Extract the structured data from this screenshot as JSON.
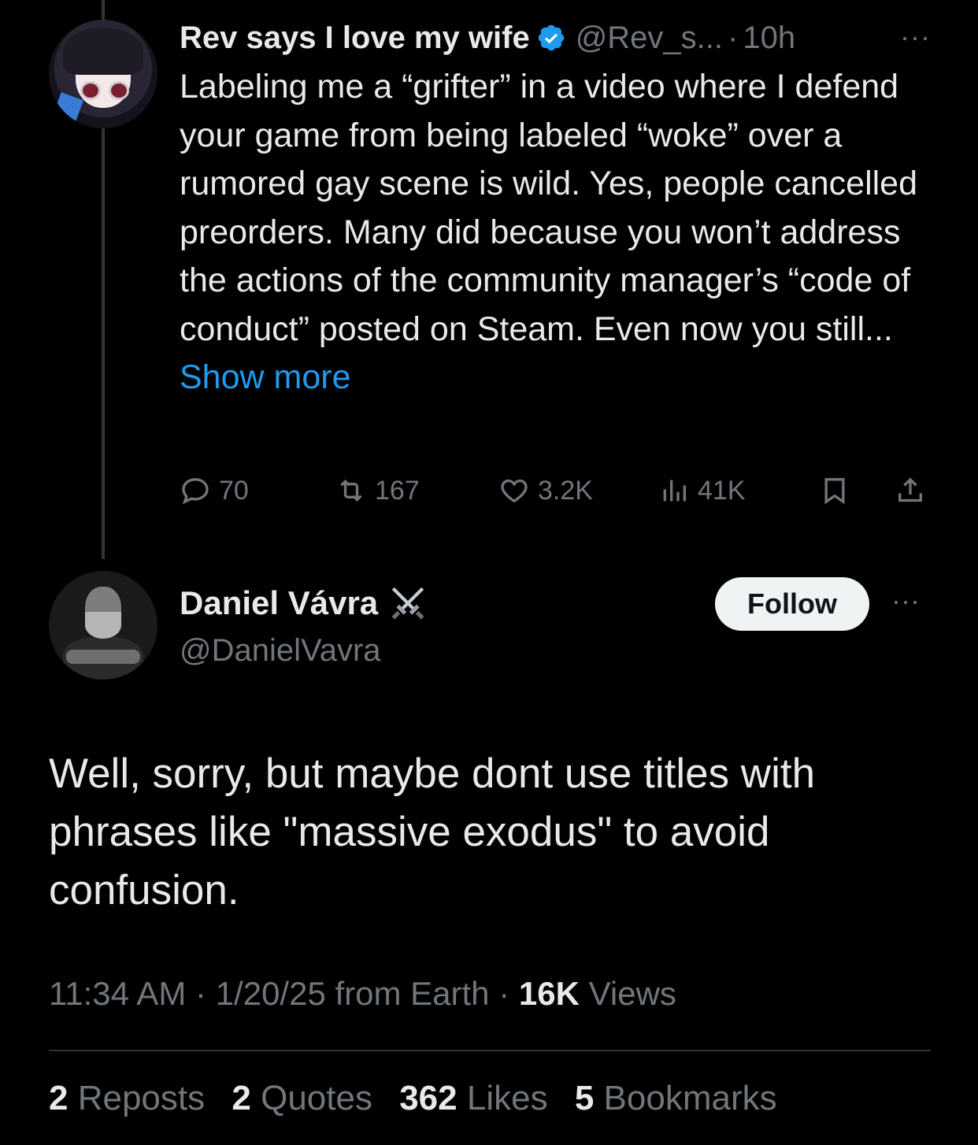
{
  "reply_tweet": {
    "display_name": "Rev says I love my wife",
    "handle": "@Rev_s...",
    "separator": "·",
    "time": "10h",
    "more_icon": "···",
    "body": "Labeling me a “grifter” in a video where I defend your game from being labeled “woke” over a rumored gay scene is wild. Yes, people cancelled preorders. Many did because you won’t address the actions of the community manager’s “code of conduct” posted on Steam. Even now you still...",
    "show_more": "Show more",
    "replies": "70",
    "reposts": "167",
    "likes": "3.2K",
    "views": "41K",
    "colors": {
      "verified": "#1d9bf0",
      "link": "#1d9bf0"
    }
  },
  "main_tweet": {
    "display_name": "Daniel Vávra",
    "handle": "@DanielVavra",
    "follow_label": "Follow",
    "more_icon": "···",
    "text": "Well, sorry, but maybe dont use titles with phrases like \"massive exodus\" to avoid confusion.",
    "time": "11:34 AM",
    "date": "1/20/25 from Earth",
    "dot": "·",
    "views_count": "16K",
    "views_label": "Views",
    "stats": [
      {
        "count": "2",
        "label": "Reposts"
      },
      {
        "count": "2",
        "label": "Quotes"
      },
      {
        "count": "362",
        "label": "Likes"
      },
      {
        "count": "5",
        "label": "Bookmarks"
      }
    ]
  }
}
